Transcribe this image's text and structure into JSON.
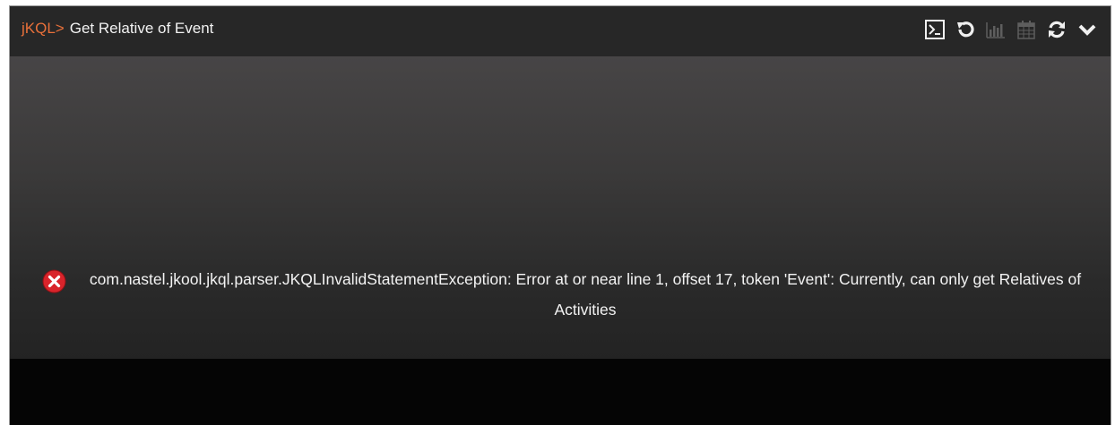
{
  "header": {
    "prefix": "jKQL>",
    "title": "Get Relative of Event"
  },
  "toolbar": {
    "icons": [
      "terminal-icon",
      "undo-icon",
      "bar-chart-icon",
      "calendar-icon",
      "refresh-icon",
      "chevron-down-icon"
    ]
  },
  "error": {
    "icon": "error-icon",
    "message": "com.nastel.jkool.jkql.parser.JKQLInvalidStatementException: Error at or near line 1, offset 17, token 'Event': Currently, can only get Relatives of Activities"
  },
  "colors": {
    "prefix": "#e8703a",
    "error_icon": "#d9242b",
    "header_bg": "#272727",
    "text": "#f3f3f3"
  }
}
